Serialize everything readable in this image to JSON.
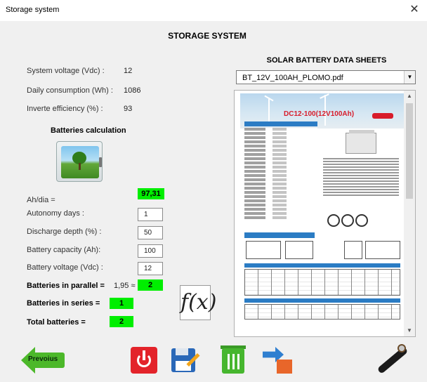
{
  "window": {
    "title": "Storage system",
    "close_glyph": "✕"
  },
  "heading": "STORAGE SYSTEM",
  "datasheets": {
    "heading": "SOLAR BATTERY DATA SHEETS",
    "selected_file": "BT_12V_100AH_PLOMO.pdf",
    "document": {
      "model_text": "DC12-100(12V100Ah)"
    }
  },
  "system": {
    "voltage_label": "System voltage (Vdc) :",
    "voltage_value": "12",
    "consumption_label": "Daily consumption (Wh) :",
    "consumption_value": "1086",
    "efficiency_label": "Inverte efficiency (%) :",
    "efficiency_value": "93"
  },
  "batteries": {
    "section_title": "Batteries calculation",
    "ah_dia_label": "Ah/dia =",
    "ah_dia_value": "97,31",
    "autonomy_label": "Autonomy days :",
    "autonomy_value": "1",
    "discharge_label": "Discharge depth (%) :",
    "discharge_value": "50",
    "capacity_label": "Battery capacity (Ah):",
    "capacity_value": "100",
    "battery_voltage_label": "Battery voltage (Vdc) :",
    "battery_voltage_value": "12",
    "parallel_label": "Batteries in parallel =",
    "parallel_approx": "1,95 ≈",
    "parallel_value": "2",
    "series_label": "Batteries in series =",
    "series_value": "1",
    "total_label": "Total batteries =",
    "total_value": "2"
  },
  "toolbar": {
    "previous_label": "Prevoius"
  },
  "colors": {
    "highlight_green": "#00ee00",
    "previous_green": "#4cb82a",
    "power_red": "#e3232a",
    "trash_green": "#46b62e",
    "accent_blue": "#2a68b8"
  },
  "icons": {
    "fx": "fx-icon",
    "power": "power-icon",
    "save": "save-edit-icon",
    "trash": "trash-icon",
    "export": "export-icon",
    "cable": "cable-icon",
    "battery": "battery-solar-icon"
  }
}
